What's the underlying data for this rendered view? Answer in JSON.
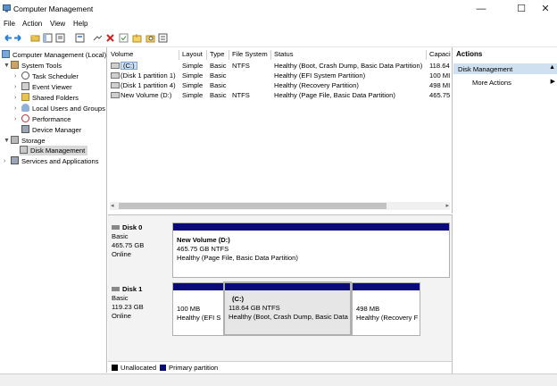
{
  "window": {
    "title": "Computer Management",
    "minimize": "—",
    "maximize": "☐",
    "close": "✕"
  },
  "menu": {
    "file": "File",
    "action": "Action",
    "view": "View",
    "help": "Help"
  },
  "tree": {
    "root": "Computer Management (Local)",
    "system_tools": "System Tools",
    "task_scheduler": "Task Scheduler",
    "event_viewer": "Event Viewer",
    "shared_folders": "Shared Folders",
    "local_users": "Local Users and Groups",
    "performance": "Performance",
    "device_manager": "Device Manager",
    "storage": "Storage",
    "disk_management": "Disk Management",
    "services": "Services and Applications"
  },
  "list": {
    "columns": [
      "Volume",
      "Layout",
      "Type",
      "File System",
      "Status",
      "Capaci"
    ],
    "rows": [
      [
        "(C:)",
        "Simple",
        "Basic",
        "NTFS",
        "Healthy (Boot, Crash Dump, Basic Data Partition)",
        "118.64"
      ],
      [
        "(Disk 1 partition 1)",
        "Simple",
        "Basic",
        "",
        "Healthy (EFI System Partition)",
        "100 MI"
      ],
      [
        "(Disk 1 partition 4)",
        "Simple",
        "Basic",
        "",
        "Healthy (Recovery Partition)",
        "498 MI"
      ],
      [
        "New Volume (D:)",
        "Simple",
        "Basic",
        "NTFS",
        "Healthy (Page File, Basic Data Partition)",
        "465.75"
      ]
    ]
  },
  "disks": {
    "disk0": {
      "name": "Disk 0",
      "type": "Basic",
      "size": "465.75 GB",
      "state": "Online",
      "p1": {
        "name": "New Volume  (D:)",
        "size": "465.75 GB NTFS",
        "status": "Healthy (Page File, Basic Data Partition)"
      }
    },
    "disk1": {
      "name": "Disk 1",
      "type": "Basic",
      "size": "119.23 GB",
      "state": "Online",
      "p1": {
        "size": "100 MB",
        "status": "Healthy (EFI S"
      },
      "p2": {
        "name": "(C:)",
        "size": "118.64 GB NTFS",
        "status": "Healthy (Boot, Crash Dump, Basic Data"
      },
      "p3": {
        "size": "498 MB",
        "status": "Healthy (Recovery F"
      }
    }
  },
  "legend": {
    "unallocated": "Unallocated",
    "primary": "Primary partition"
  },
  "actions": {
    "header": "Actions",
    "section": "Disk Management",
    "more": "More Actions"
  },
  "colors": {
    "partition_bar": "#0a0a7a",
    "selected_action": "#cfe0f1",
    "unallocated": "#000000"
  }
}
